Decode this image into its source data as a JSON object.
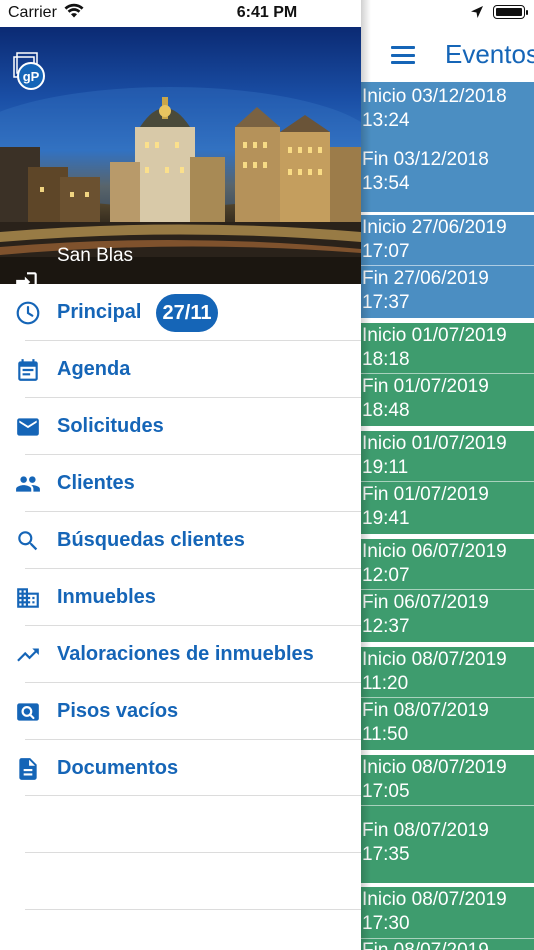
{
  "status_bar": {
    "carrier": "Carrier",
    "time": "6:41 PM"
  },
  "events_screen": {
    "title": "Eventos",
    "events": [
      {
        "start": "Inicio 03/12/2018 13:24",
        "end": "Fin 03/12/2018 13:54",
        "color": "#4b8ec2"
      },
      {
        "start": "Inicio 27/06/2019 17:07",
        "end": "Fin 27/06/2019 17:37",
        "color": "#4b8ec2"
      },
      {
        "start": "Inicio 01/07/2019 18:18",
        "end": "Fin 01/07/2019 18:48",
        "color": "#3e9c6e"
      },
      {
        "start": "Inicio 01/07/2019 19:11",
        "end": "Fin 01/07/2019 19:41",
        "color": "#3e9c6e"
      },
      {
        "start": "Inicio 06/07/2019 12:07",
        "end": "Fin 06/07/2019 12:37",
        "color": "#3e9c6e"
      },
      {
        "start": "Inicio 08/07/2019 11:20",
        "end": "Fin 08/07/2019 11:50",
        "color": "#3e9c6e"
      },
      {
        "start": "Inicio 08/07/2019 17:05",
        "end": "Fin 08/07/2019 17:35",
        "color": "#3e9c6e"
      },
      {
        "start": "Inicio 08/07/2019 17:30",
        "end": "Fin 08/07/2019",
        "color": "#3e9c6e"
      }
    ]
  },
  "drawer": {
    "logo_text": "gP",
    "user_name": "San Blas",
    "accent_color": "#1565b7",
    "menu": [
      {
        "label": "Principal",
        "icon": "clock-icon",
        "badge": "27/11"
      },
      {
        "label": "Agenda",
        "icon": "calendar-icon"
      },
      {
        "label": "Solicitudes",
        "icon": "mail-icon"
      },
      {
        "label": "Clientes",
        "icon": "people-icon"
      },
      {
        "label": "Búsquedas clientes",
        "icon": "search-icon"
      },
      {
        "label": "Inmuebles",
        "icon": "building-icon"
      },
      {
        "label": "Valoraciones de inmuebles",
        "icon": "trending-up-icon"
      },
      {
        "label": "Pisos vacíos",
        "icon": "image-search-icon"
      },
      {
        "label": "Documentos",
        "icon": "document-icon"
      }
    ]
  }
}
